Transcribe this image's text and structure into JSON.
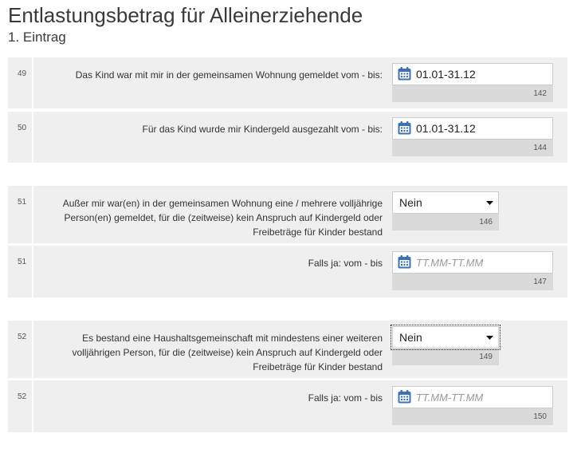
{
  "header": {
    "title": "Entlastungsbetrag für Alleinerziehende",
    "subtitle": "1. Eintrag"
  },
  "rows": [
    {
      "number": "49",
      "label": [
        "Das Kind war mit mir in der gemeinsamen Wohnung gemeldet vom - bis:"
      ],
      "date": {
        "value": "01.01-31.12"
      },
      "code": "142"
    },
    {
      "number": "50",
      "label": [
        "Für das Kind wurde mir Kindergeld ausgezahlt vom - bis:"
      ],
      "date": {
        "value": "01.01-31.12"
      },
      "code": "144"
    },
    {
      "number": "51",
      "label": [
        "Außer mir war(en) in der gemeinsamen Wohnung eine / mehrere volljährige",
        "Person(en) gemeldet, für die (zeitweise) kein Anspruch auf Kindergeld oder",
        "Freibeträge für Kinder bestand"
      ],
      "select": {
        "value": "Nein",
        "focused": false
      },
      "code": "146"
    },
    {
      "number": "51",
      "label": [
        "Falls ja: vom - bis"
      ],
      "date": {
        "placeholder": "TT.MM-TT.MM"
      },
      "code": "147"
    },
    {
      "number": "52",
      "label": [
        "Es bestand eine Haushaltsgemeinschaft mit mindestens einer weiteren",
        "volljährigen Person, für die (zeitweise) kein Anspruch auf Kindergeld oder",
        "Freibeträge für Kinder bestand"
      ],
      "select": {
        "value": "Nein",
        "focused": true
      },
      "code": "149"
    },
    {
      "number": "52",
      "label": [
        "Falls ja: vom - bis"
      ],
      "date": {
        "placeholder": "TT.MM-TT.MM"
      },
      "code": "150"
    }
  ],
  "icons": {
    "date_field": "calendar-icon",
    "select_arrow": "chevron-down-icon"
  },
  "colors": {
    "row_bg": "#efefef",
    "code_bg": "#dadada",
    "field_border": "#cccccc",
    "icon_blue": "#3d71b3",
    "text": "#333333",
    "placeholder": "#9a9a9a"
  }
}
